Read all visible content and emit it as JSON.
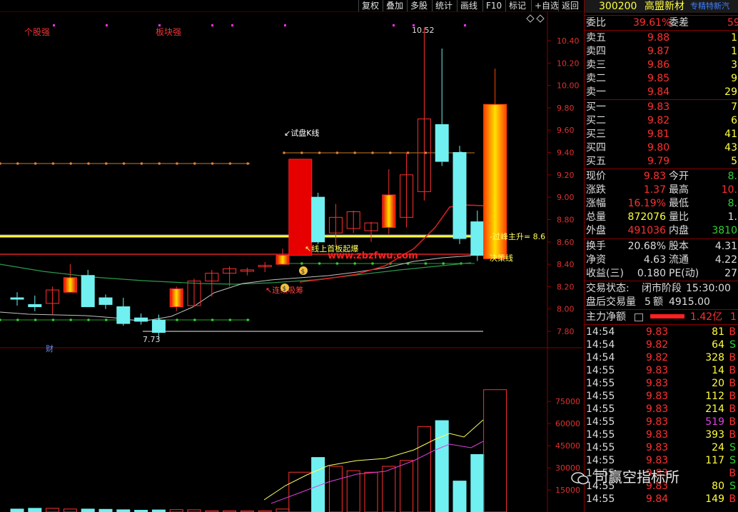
{
  "toolbar": {
    "items": [
      "复权",
      "叠加",
      "多股",
      "统计",
      "画线",
      "F10",
      "标记",
      "+自选",
      "返回"
    ]
  },
  "stock": {
    "code": "300200",
    "name": "高盟新材",
    "scroll_text": "专精特新汽"
  },
  "legend": {
    "geguqiang": "个股强",
    "bankuaiqiang": "板块强"
  },
  "price_axis": {
    "ticks": [
      "10.40",
      "10.20",
      "10.00",
      "9.80",
      "9.60",
      "9.40",
      "9.20",
      "9.00",
      "8.80",
      "8.60",
      "8.40",
      "8.20",
      "8.00",
      "7.80"
    ]
  },
  "volume_axis": {
    "ticks": [
      "75000",
      "60000",
      "45000",
      "30000",
      "15000"
    ]
  },
  "annotations": {
    "high": "10.52",
    "low": "7.73",
    "shipan": "↙试盘K线",
    "xianshang": "↖线上首板起爆",
    "guofeng": "-过峰主升= 8.6",
    "juece": "决策线",
    "xichou": "↖连续吸筹",
    "cai": "财",
    "website": "www.zbzfwu.com"
  },
  "quote": {
    "weibi_label": "委比",
    "weibi": "39.61%",
    "weicha_label": "委差",
    "weicha": "59",
    "asks": [
      {
        "label": "卖五",
        "price": "9.88",
        "vol": "1"
      },
      {
        "label": "卖四",
        "price": "9.87",
        "vol": "1"
      },
      {
        "label": "卖三",
        "price": "9.86",
        "vol": "3"
      },
      {
        "label": "卖二",
        "price": "9.85",
        "vol": "9"
      },
      {
        "label": "卖一",
        "price": "9.84",
        "vol": "29"
      }
    ],
    "bids": [
      {
        "label": "买一",
        "price": "9.83",
        "vol": "7"
      },
      {
        "label": "买二",
        "price": "9.82",
        "vol": "6"
      },
      {
        "label": "买三",
        "price": "9.81",
        "vol": "41"
      },
      {
        "label": "买四",
        "price": "9.80",
        "vol": "43"
      },
      {
        "label": "买五",
        "price": "9.79",
        "vol": "5"
      }
    ],
    "stats": [
      {
        "l1": "现价",
        "v1": "9.83",
        "l2": "今开",
        "v2": "8."
      },
      {
        "l1": "涨跌",
        "v1": "1.37",
        "l2": "最高",
        "v2": "10."
      },
      {
        "l1": "涨幅",
        "v1": "16.19%",
        "l2": "最低",
        "v2": "8."
      },
      {
        "l1": "总量",
        "v1": "872076",
        "l2": "量比",
        "v2": "1."
      },
      {
        "l1": "外盘",
        "v1": "491036",
        "l2": "内盘",
        "v2": "3810"
      }
    ],
    "stats2": [
      {
        "l1": "换手",
        "v1": "20.68%",
        "l2": "股本",
        "v2": "4.31"
      },
      {
        "l1": "净资",
        "v1": "4.63",
        "l2": "流通",
        "v2": "4.22"
      },
      {
        "l1": "收益(三)",
        "v1": "0.180",
        "l2": "PE(动)",
        "v2": "27"
      }
    ],
    "status_label": "交易状态:",
    "status": "闭市阶段",
    "status_time": "15:30:00",
    "after_label": "盘后交易量",
    "after_vol": "5",
    "after_amt_label": "额",
    "after_amt": "4915.00",
    "zhuli_label": "主力净额",
    "zhuli": "1.42亿",
    "zhuli_tail": "1"
  },
  "ticks": [
    {
      "t": "14:54",
      "p": "9.83",
      "v": "81",
      "s": "B"
    },
    {
      "t": "14:54",
      "p": "9.82",
      "v": "64",
      "s": "S"
    },
    {
      "t": "14:54",
      "p": "9.82",
      "v": "328",
      "s": "B"
    },
    {
      "t": "14:55",
      "p": "9.83",
      "v": "14",
      "s": "B"
    },
    {
      "t": "14:55",
      "p": "9.83",
      "v": "20",
      "s": "B"
    },
    {
      "t": "14:55",
      "p": "9.83",
      "v": "112",
      "s": "B"
    },
    {
      "t": "14:55",
      "p": "9.83",
      "v": "214",
      "s": "B"
    },
    {
      "t": "14:55",
      "p": "9.83",
      "v": "519",
      "s": "B"
    },
    {
      "t": "14:55",
      "p": "9.83",
      "v": "393",
      "s": "B"
    },
    {
      "t": "14:55",
      "p": "9.83",
      "v": "24",
      "s": "S"
    },
    {
      "t": "14:55",
      "p": "9.83",
      "v": "117",
      "s": "S"
    },
    {
      "t": "14:55",
      "p": "9.83",
      "v": "",
      "s": "B"
    },
    {
      "t": "14:55",
      "p": "9.83",
      "v": "80",
      "s": "S"
    },
    {
      "t": "14:55",
      "p": "9.84",
      "v": "149",
      "s": "B"
    }
  ],
  "watermark": "司赢空指标所",
  "chart_data": {
    "type": "candlestick",
    "price_range": [
      7.7,
      10.6
    ],
    "candles": [
      {
        "o": 8.1,
        "h": 8.15,
        "l": 8.03,
        "c": 8.1,
        "up": false
      },
      {
        "o": 8.02,
        "h": 8.12,
        "l": 7.98,
        "c": 8.04,
        "up": false
      },
      {
        "o": 8.05,
        "h": 8.2,
        "l": 7.95,
        "c": 8.17,
        "up": true
      },
      {
        "o": 8.28,
        "h": 8.4,
        "l": 8.2,
        "c": 8.15,
        "up": true
      },
      {
        "o": 8.3,
        "h": 8.35,
        "l": 8.02,
        "c": 8.02,
        "up": false
      },
      {
        "o": 8.1,
        "h": 8.13,
        "l": 8.0,
        "c": 8.04,
        "up": false
      },
      {
        "o": 8.02,
        "h": 8.1,
        "l": 7.85,
        "c": 7.87,
        "up": false
      },
      {
        "o": 7.92,
        "h": 7.96,
        "l": 7.86,
        "c": 7.89,
        "up": false
      },
      {
        "o": 7.9,
        "h": 7.95,
        "l": 7.73,
        "c": 7.79,
        "up": false
      },
      {
        "o": 8.02,
        "h": 8.2,
        "l": 7.98,
        "c": 8.18,
        "up": true
      },
      {
        "o": 8.03,
        "h": 8.27,
        "l": 8.02,
        "c": 8.25,
        "up": true
      },
      {
        "o": 8.25,
        "h": 8.35,
        "l": 8.11,
        "c": 8.32,
        "up": true
      },
      {
        "o": 8.32,
        "h": 8.38,
        "l": 8.2,
        "c": 8.36,
        "up": true
      },
      {
        "o": 8.35,
        "h": 8.37,
        "l": 8.3,
        "c": 8.34,
        "up": true
      },
      {
        "o": 8.39,
        "h": 8.42,
        "l": 8.33,
        "c": 8.38,
        "up": true
      },
      {
        "o": 8.4,
        "h": 8.54,
        "l": 8.4,
        "c": 8.48,
        "up": true
      },
      {
        "o": 8.48,
        "h": 9.34,
        "l": 8.48,
        "c": 9.34,
        "up": true
      },
      {
        "o": 9.0,
        "h": 9.04,
        "l": 8.58,
        "c": 8.6,
        "up": false
      },
      {
        "o": 8.68,
        "h": 8.94,
        "l": 8.55,
        "c": 8.82,
        "up": true
      },
      {
        "o": 8.72,
        "h": 8.88,
        "l": 8.68,
        "c": 8.87,
        "up": true
      },
      {
        "o": 8.7,
        "h": 8.78,
        "l": 8.6,
        "c": 8.77,
        "up": true
      },
      {
        "o": 8.73,
        "h": 9.25,
        "l": 8.67,
        "c": 9.02,
        "up": true
      },
      {
        "o": 8.82,
        "h": 9.4,
        "l": 8.73,
        "c": 9.2,
        "up": true
      },
      {
        "o": 9.05,
        "h": 10.52,
        "l": 8.97,
        "c": 9.7,
        "up": true
      },
      {
        "o": 9.65,
        "h": 10.33,
        "l": 9.28,
        "c": 9.32,
        "up": false
      },
      {
        "o": 9.4,
        "h": 9.46,
        "l": 8.58,
        "c": 8.63,
        "up": false
      },
      {
        "o": 8.78,
        "h": 8.88,
        "l": 8.43,
        "c": 8.48,
        "up": false
      },
      {
        "o": 8.45,
        "h": 10.15,
        "l": 8.45,
        "c": 9.83,
        "up": true
      }
    ],
    "volumes": [
      2000,
      2500,
      2500,
      2000,
      2000,
      1800,
      1500,
      1200,
      1400,
      1600,
      1500,
      800,
      800,
      700,
      800,
      2000,
      27000,
      37000,
      31000,
      28000,
      27000,
      31000,
      35000,
      58000,
      62000,
      21000,
      39000,
      83000
    ]
  }
}
